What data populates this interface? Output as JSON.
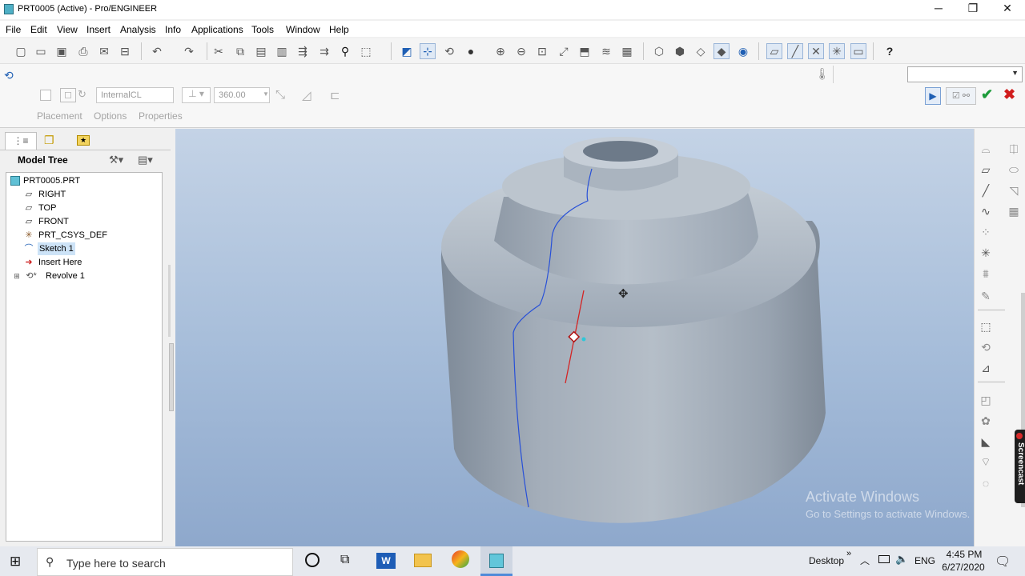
{
  "window": {
    "title": "PRT0005 (Active) - Pro/ENGINEER",
    "minimize": "─",
    "restore": "❐",
    "close": "✕"
  },
  "menubar": {
    "items": [
      "File",
      "Edit",
      "View",
      "Insert",
      "Analysis",
      "Info",
      "Applications",
      "Tools",
      "Window",
      "Help"
    ]
  },
  "toolbar": {
    "icons": [
      "new-icon",
      "open-icon",
      "save-icon",
      "print-icon",
      "email-icon",
      "print-preview-icon",
      "undo-icon",
      "redo-icon",
      "cut-icon",
      "copy-icon",
      "paste-icon",
      "paste-special-icon",
      "regenerate-icon",
      "regen-manager-icon",
      "find-icon",
      "select-box-icon",
      "repaint-icon",
      "spin-center-icon",
      "orient-icon",
      "appearance-icon",
      "zoom-in-icon",
      "zoom-out-icon",
      "refit-icon",
      "reorient-icon",
      "saved-views-icon",
      "layers-icon",
      "view-manager-icon",
      "wireframe-icon",
      "hidden-line-icon",
      "no-hidden-icon",
      "shading-icon",
      "enhanced-realism-icon",
      "datum-planes-icon",
      "datum-axes-icon",
      "datum-points-icon",
      "csys-icon",
      "annotations-icon",
      "whats-this-icon"
    ]
  },
  "dashboard": {
    "axis_value": "InternalCL",
    "angle_value": "360.00",
    "tabs": [
      "Placement",
      "Options",
      "Properties"
    ],
    "dropdown_value": ""
  },
  "modeltree": {
    "title": "Model Tree",
    "items": [
      {
        "label": "PRT0005.PRT",
        "icon": "part-icon"
      },
      {
        "label": "RIGHT",
        "icon": "datum-plane-icon"
      },
      {
        "label": "TOP",
        "icon": "datum-plane-icon"
      },
      {
        "label": "FRONT",
        "icon": "datum-plane-icon"
      },
      {
        "label": "PRT_CSYS_DEF",
        "icon": "csys-icon"
      },
      {
        "label": "Sketch 1",
        "icon": "sketch-icon"
      },
      {
        "label": "Insert Here",
        "icon": "insert-arrow-icon"
      },
      {
        "label": "Revolve 1",
        "icon": "revolve-icon"
      }
    ]
  },
  "viewport": {
    "watermark_title": "Activate Windows",
    "watermark_sub": "Go to Settings to activate Windows."
  },
  "side_tab": {
    "label": "Screencast"
  },
  "taskbar": {
    "search_placeholder": "Type here to search",
    "desktop_label": "Desktop",
    "lang": "ENG",
    "time": "4:45 PM",
    "date": "6/27/2020"
  },
  "colors": {
    "accent": "#1f5fb4",
    "ok": "#1d9b3a",
    "cancel": "#d11d1d",
    "viewport_top": "#c4d3e6",
    "viewport_bottom": "#8ea8cc"
  }
}
